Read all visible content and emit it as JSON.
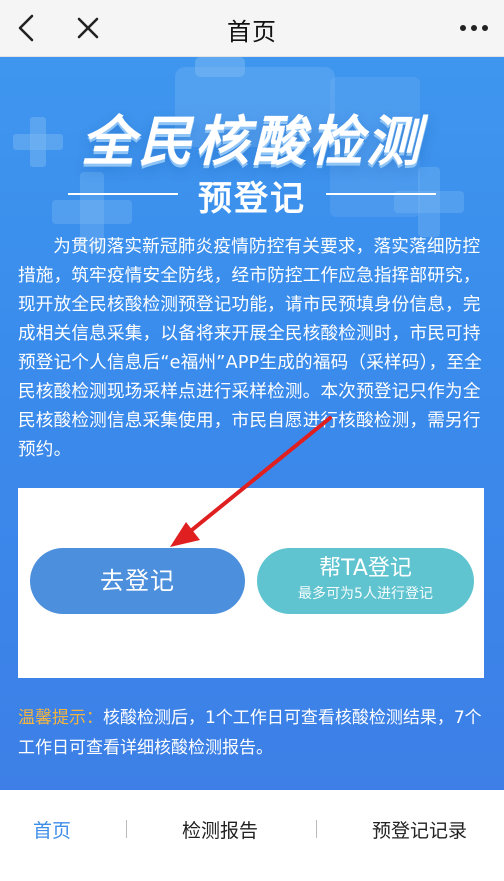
{
  "topbar": {
    "title": "首页"
  },
  "hero": {
    "title": "全民核酸检测",
    "subtitle": "预登记",
    "intro": "为贯彻落实新冠肺炎疫情防控有关要求，落实落细防控措施，筑牢疫情安全防线，经市防控工作应急指挥部研究，现开放全民核酸检测预登记功能，请市民预填身份信息，完成相关信息采集，以备将来开展全民核酸检测时，市民可持预登记个人信息后“e福州”APP生成的福码（采样码），至全民核酸检测现场采样点进行采样检测。本次预登记只作为全民核酸检测信息采集使用，市民自愿进行核酸检测，需另行预约。"
  },
  "card": {
    "register_label": "去登记",
    "help_label": "帮TA登记",
    "help_sub": "最多可为5人进行登记"
  },
  "tip": {
    "label": "温馨提示：",
    "text": "核酸检测后，1个工作日可查看核酸检测结果，7个工作日可查看详细核酸检测报告。"
  },
  "tabbar": {
    "items": [
      "首页",
      "检测报告",
      "预登记记录"
    ],
    "active": 0
  },
  "colors": {
    "hero_blue": "#3d8bec",
    "register_button": "#4c8fdd",
    "help_button": "#5fc4cf",
    "tip_label": "#f4b53f",
    "active_tab": "#3e8ee9",
    "arrow": "#e02020"
  }
}
